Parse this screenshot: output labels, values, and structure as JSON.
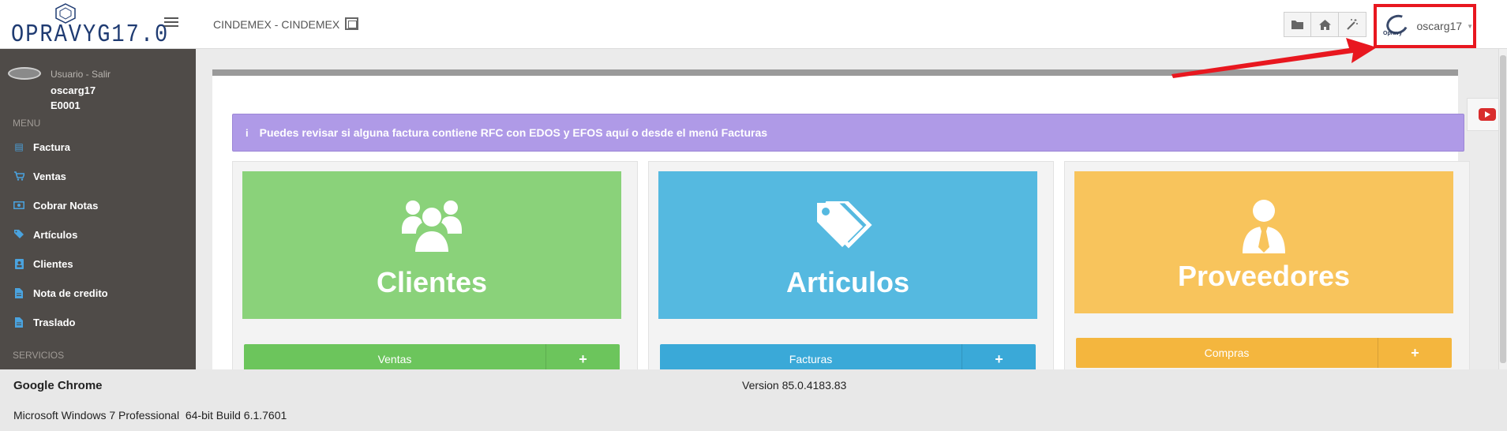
{
  "header": {
    "logo_text": "OPRAVYG17.0",
    "company": "CINDEMEX - CINDEMEX",
    "toolbar_icons": [
      "folder-icon",
      "home-icon",
      "magic-wand-icon"
    ],
    "user": {
      "name": "oscarg17",
      "logo_label": "Opravy"
    }
  },
  "sidebar": {
    "user_label": "Usuario - Salir",
    "user_name": "oscarg17",
    "user_code": "E0001",
    "menu_label": "MENU",
    "items": [
      {
        "label": "Factura",
        "icon": "invoice-icon"
      },
      {
        "label": "Ventas",
        "icon": "cart-icon"
      },
      {
        "label": "Cobrar Notas",
        "icon": "money-icon"
      },
      {
        "label": "Artículos",
        "icon": "tags-icon"
      },
      {
        "label": "Clientes",
        "icon": "address-book-icon"
      },
      {
        "label": "Nota de credito",
        "icon": "document-icon"
      },
      {
        "label": "Traslado",
        "icon": "document-icon"
      }
    ],
    "services_label": "SERVICIOS"
  },
  "alert": {
    "icon": "i",
    "text": "Puedes revisar si alguna factura contiene RFC con EDOS y EFOS aquí o desde el menú Facturas"
  },
  "cards": [
    {
      "title": "Clientes",
      "button": "Ventas",
      "plus": "+",
      "color": "#8ad27a",
      "button_color": "#6cc55c",
      "icon": "users-icon"
    },
    {
      "title": "Articulos",
      "button": "Facturas",
      "plus": "+",
      "color": "#55b9e0",
      "button_color": "#3aa9d8",
      "icon": "tags-icon"
    },
    {
      "title": "Proveedores",
      "button": "Compras",
      "plus": "+",
      "color": "#f8c45c",
      "button_color": "#f4b63e",
      "icon": "user-tie-icon"
    }
  ],
  "system_info": {
    "app": "Google Chrome",
    "version": "Version 85.0.4183.83",
    "os": "Microsoft Windows 7 Professional  64-bit Build 6.1.7601"
  }
}
